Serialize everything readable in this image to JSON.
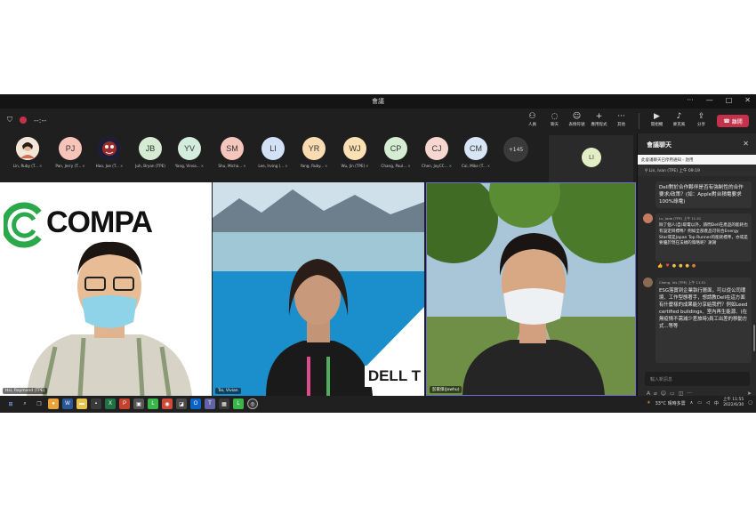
{
  "window": {
    "title": "會議"
  },
  "toolbar": {
    "timer": "--:--",
    "buttons": [
      {
        "label": "人員",
        "icon": "people-icon"
      },
      {
        "label": "聊天",
        "icon": "chat-icon"
      },
      {
        "label": "表情符號",
        "icon": "smile-icon"
      },
      {
        "label": "應用程式",
        "icon": "add-icon"
      },
      {
        "label": "其他",
        "icon": "more-icon"
      }
    ],
    "camera_label": "開相機",
    "mic_label": "麥克風",
    "share_label": "分享",
    "leave_label": "離開"
  },
  "participants": [
    {
      "name": "Lin, Ruby (T...",
      "initials": "",
      "color": "#f4c9a8"
    },
    {
      "name": "Pan, Jerry (T...",
      "initials": "PJ",
      "color": "#f6c4b9"
    },
    {
      "name": "Hao, Joe (T...",
      "initials": "",
      "color": "#8b2a2a"
    },
    {
      "name": "Juh, Bryan (TPE)",
      "initials": "JB",
      "color": "#d6ecd2"
    },
    {
      "name": "Yang, Vinsa...",
      "initials": "YV",
      "color": "#d4ecdc"
    },
    {
      "name": "Shu, Micha...",
      "initials": "SM",
      "color": "#f6c6bd"
    },
    {
      "name": "Lee, Irving (...",
      "initials": "LI",
      "color": "#d3e1f6"
    },
    {
      "name": "Yang, Ruby...",
      "initials": "YR",
      "color": "#f9dcb1"
    },
    {
      "name": "Wu, Jin (TPE)",
      "initials": "WJ",
      "color": "#fbe0b4"
    },
    {
      "name": "Chang, Paul...",
      "initials": "CP",
      "color": "#d4edd3"
    },
    {
      "name": "Chen, JoyCC...",
      "initials": "CJ",
      "color": "#f7d7cf"
    },
    {
      "name": "Cai, Mike (T...",
      "initials": "CM",
      "color": "#d6e6f5"
    }
  ],
  "more_count": "+145",
  "spotlight": {
    "initials": "LI"
  },
  "tiles": {
    "speaker1": {
      "name": "Hsi, Raymond (TPE)",
      "brand": "COMPA"
    },
    "speaker2": {
      "name": "Tai, Vivian",
      "brand": "DELL T"
    },
    "speaker3": {
      "name": "彭家偉(Jowhu)"
    }
  },
  "chat": {
    "title": "會議聊天",
    "banner": "此會議聊天已停用通知 - 啟用",
    "pinned": "Lin, Ivan (TPE)  上午 09:19",
    "messages": [
      {
        "meta": "",
        "body": "Dell對於合作夥伴是否有強制性的合作要求/政策？(如：Apple對台積電要求100%綠電)"
      },
      {
        "meta": "Lu, Jade (TPE)  上午 11:41",
        "body": "除了個人(自)取電以外，請問Dell在產品的能耗也有設定目標嗎？例如全部產品可符合Energy Star或是Japan Top Runner的能耗標準，亦或是要優於現在法規的策略呢？謝謝"
      },
      {
        "meta": "Cheng, Iris (TPE)  上午 11:51",
        "body": "ESG落實到企業執行層面，可以從公司環境、工作型態著手，想請教Dell在這方面有什麼樣的成果能分享給我們？例如Leed certified buildings、室內再生能源、(在無疫情不需減少差旅時)員工出差的移動方式...等等"
      }
    ],
    "input_placeholder": "輸入新訊息"
  },
  "taskbar": {
    "weather": "33°C  晴時多雲",
    "time": "上午 11:55",
    "date": "2022/6/30"
  }
}
